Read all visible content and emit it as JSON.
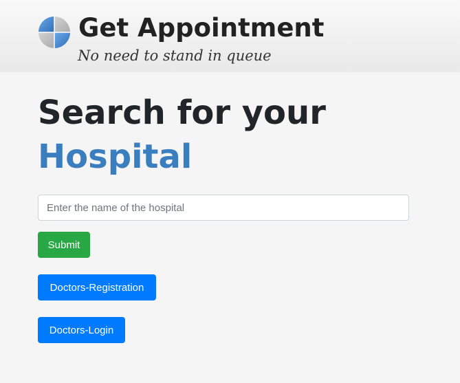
{
  "header": {
    "title": "Get Appointment",
    "tagline": "No need to stand in queue",
    "logo_icon": "globe-logo-icon"
  },
  "main": {
    "heading_line1": "Search for your",
    "heading_line2": "Hospital",
    "search": {
      "placeholder": "Enter the name of the hospital",
      "value": ""
    },
    "submit_label": "Submit",
    "doctors_registration_label": "Doctors-Registration",
    "doctors_login_label": "Doctors-Login"
  },
  "colors": {
    "accent": "#3a7ebf",
    "submit": "#28a745",
    "primary": "#007bff",
    "background": "#f5f5f5"
  }
}
